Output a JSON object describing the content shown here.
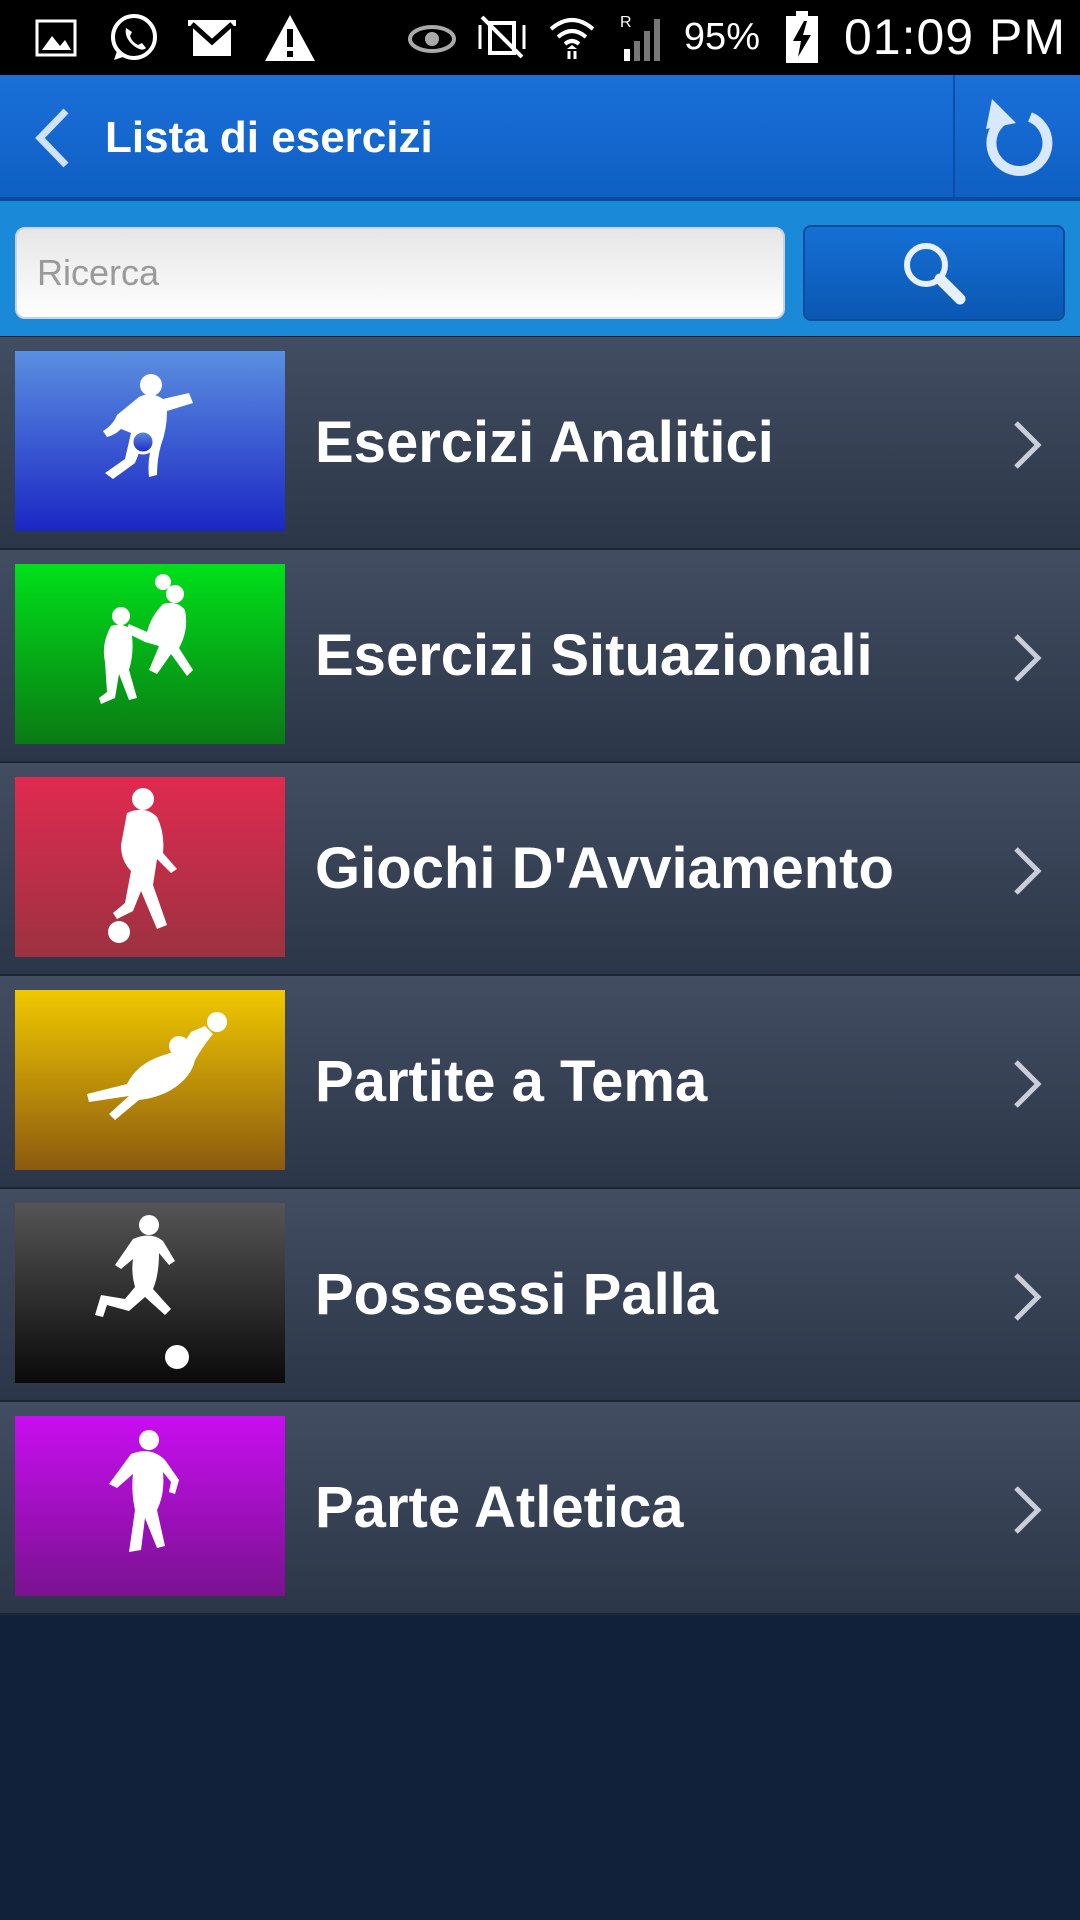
{
  "status_bar": {
    "battery_percent": "95%",
    "time": "01:09 PM",
    "left_icons": [
      "image-icon",
      "whatsapp-icon",
      "gmail-icon",
      "warning-icon"
    ],
    "right_icons": [
      "eye-icon",
      "vibrate-mute-icon",
      "wifi-icon",
      "signal-icon",
      "battery-charging-icon"
    ]
  },
  "header": {
    "title": "Lista di esercizi",
    "back_icon": "chevron-left-icon",
    "refresh_icon": "refresh-icon",
    "color": "#1a70d8"
  },
  "search": {
    "placeholder": "Ricerca",
    "value": "",
    "button_icon": "search-icon"
  },
  "list": {
    "items": [
      {
        "label": "Esercizi Analitici",
        "icon": "player-kick-icon",
        "color_top": "#5b8fe0",
        "color_bottom": "#1b27c4"
      },
      {
        "label": "Esercizi Situazionali",
        "icon": "players-header-icon",
        "color_top": "#00e01a",
        "color_bottom": "#0a7a14"
      },
      {
        "label": "Giochi D'Avviamento",
        "icon": "player-dribble-icon",
        "color_top": "#e02a50",
        "color_bottom": "#9c3240"
      },
      {
        "label": "Partite a Tema",
        "icon": "goalkeeper-dive-icon",
        "color_top": "#f0c800",
        "color_bottom": "#8c5a10"
      },
      {
        "label": "Possessi Palla",
        "icon": "player-run-ball-icon",
        "color_top": "#555555",
        "color_bottom": "#0a0a0a"
      },
      {
        "label": "Parte Atletica",
        "icon": "player-athletic-icon",
        "color_top": "#c80ef0",
        "color_bottom": "#7a1290"
      }
    ]
  }
}
